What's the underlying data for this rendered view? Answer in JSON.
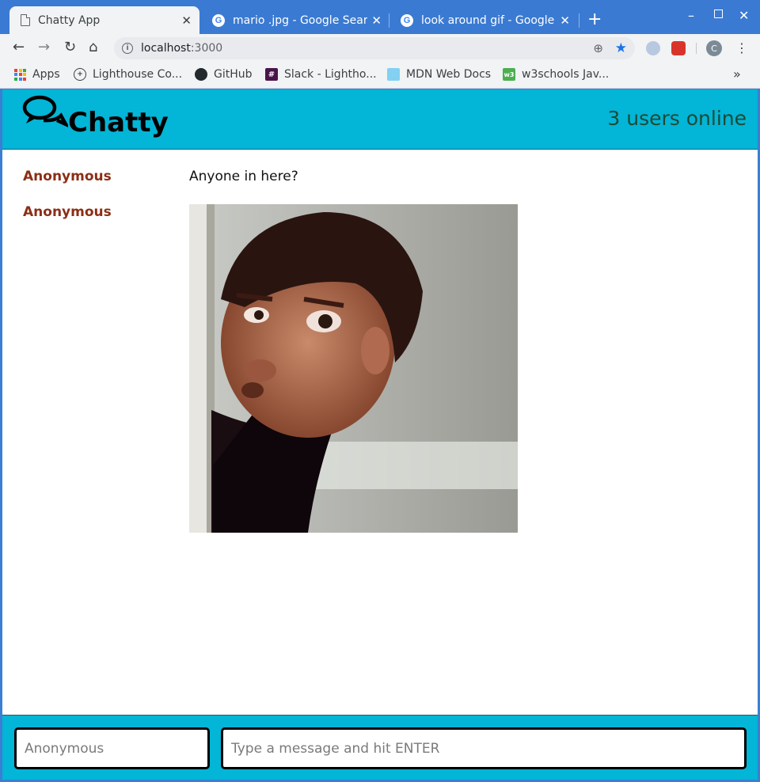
{
  "browser": {
    "tabs": [
      {
        "title": "Chatty App",
        "active": true
      },
      {
        "title": "mario .jpg - Google Search",
        "active": false
      },
      {
        "title": "look around gif - Google Search",
        "active": false
      }
    ],
    "address": {
      "host": "localhost",
      "port": ":3000"
    },
    "profile_initial": "C",
    "bookmarks": [
      {
        "label": "Apps"
      },
      {
        "label": "Lighthouse Co..."
      },
      {
        "label": "GitHub"
      },
      {
        "label": "Slack - Lightho..."
      },
      {
        "label": "MDN Web Docs"
      },
      {
        "label": "w3schools Jav..."
      }
    ]
  },
  "app": {
    "brand": "Chatty",
    "users_online": "3 users online",
    "messages": [
      {
        "username": "Anonymous",
        "content": "Anyone in here?",
        "type": "text"
      },
      {
        "username": "Anonymous",
        "content": "",
        "type": "image"
      }
    ],
    "chatbar": {
      "username_placeholder": "Anonymous",
      "message_placeholder": "Type a message and hit ENTER"
    }
  },
  "colors": {
    "navbar": "#03b5d6",
    "username": "#8b2e16",
    "chrome": "#3a7ad2"
  }
}
